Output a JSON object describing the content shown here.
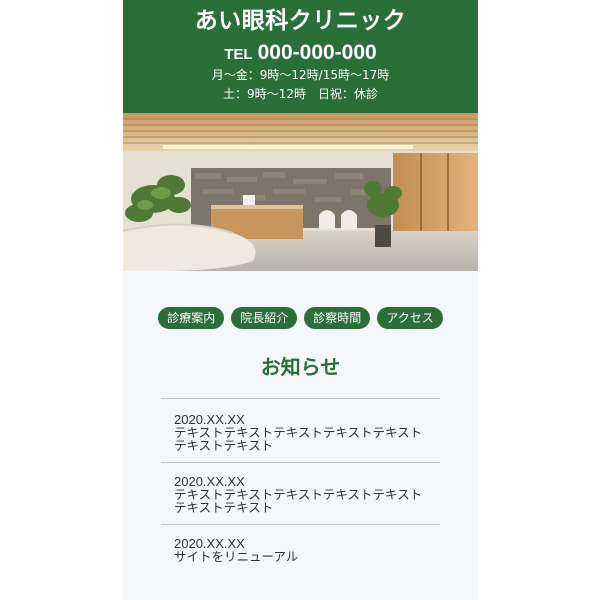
{
  "header": {
    "clinic_name": "あい眼科クリニック",
    "tel_prefix": "TEL",
    "tel_number": "000-000-000",
    "hours_weekday": "月〜金：9時〜12時/15時〜17時",
    "hours_weekend": "土：9時〜12時　日祝：休診"
  },
  "hero": {
    "icon": "clinic-lobby-photo"
  },
  "nav": {
    "items": [
      {
        "label": "診療案内"
      },
      {
        "label": "院長紹介"
      },
      {
        "label": "診察時間"
      },
      {
        "label": "アクセス"
      }
    ]
  },
  "news": {
    "title": "お知らせ",
    "items": [
      {
        "date": "2020.XX.XX",
        "text": "テキストテキストテキストテキストテキストテキストテキスト"
      },
      {
        "date": "2020.XX.XX",
        "text": "テキストテキストテキストテキストテキストテキストテキスト"
      },
      {
        "date": "2020.XX.XX",
        "text": "サイトをリニューアル"
      }
    ]
  },
  "colors": {
    "brand_green": "#2a6e3a",
    "page_bg": "#f3f7fa",
    "divider": "#bfc4c8"
  }
}
